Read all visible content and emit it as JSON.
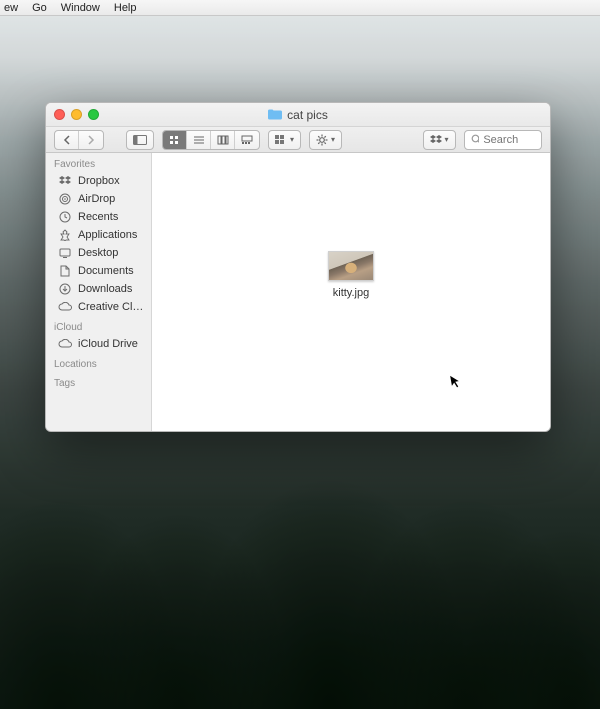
{
  "menubar": {
    "items": [
      "ew",
      "Go",
      "Window",
      "Help"
    ]
  },
  "window": {
    "title": "cat pics",
    "search_placeholder": "Search"
  },
  "sidebar": {
    "sections": [
      {
        "title": "Favorites",
        "items": [
          {
            "icon": "dropbox",
            "label": "Dropbox"
          },
          {
            "icon": "airdrop",
            "label": "AirDrop"
          },
          {
            "icon": "recents",
            "label": "Recents"
          },
          {
            "icon": "applications",
            "label": "Applications"
          },
          {
            "icon": "desktop",
            "label": "Desktop"
          },
          {
            "icon": "documents",
            "label": "Documents"
          },
          {
            "icon": "downloads",
            "label": "Downloads"
          },
          {
            "icon": "creativecloud",
            "label": "Creative Cl…"
          }
        ]
      },
      {
        "title": "iCloud",
        "items": [
          {
            "icon": "icloud",
            "label": "iCloud Drive"
          }
        ]
      },
      {
        "title": "Locations",
        "items": []
      },
      {
        "title": "Tags",
        "items": []
      }
    ]
  },
  "files": [
    {
      "name": "kitty.jpg"
    }
  ]
}
